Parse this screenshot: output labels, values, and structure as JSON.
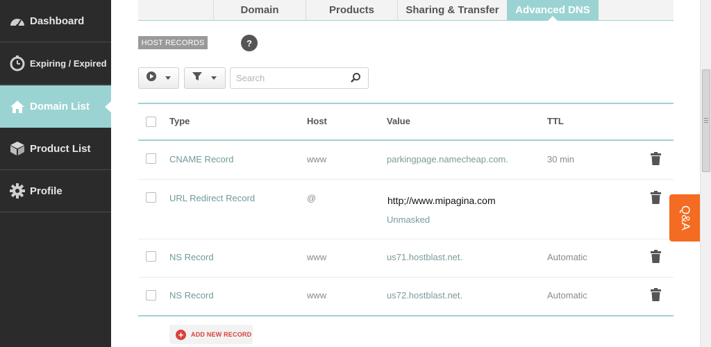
{
  "sidebar": {
    "items": [
      {
        "label": "Dashboard",
        "icon": "gauge-icon"
      },
      {
        "label": "Expiring / Expired",
        "icon": "clock-icon"
      },
      {
        "label": "Domain List",
        "icon": "home-icon",
        "active": true
      },
      {
        "label": "Product List",
        "icon": "box-icon"
      },
      {
        "label": "Profile",
        "icon": "gear-icon"
      }
    ]
  },
  "tabs": [
    {
      "label": "Domain"
    },
    {
      "label": "Products"
    },
    {
      "label": "Sharing & Transfer"
    },
    {
      "label": "Advanced DNS",
      "active": true
    }
  ],
  "host_records": {
    "label": "HOST RECORDS",
    "help": "?"
  },
  "toolbar": {
    "search_placeholder": "Search"
  },
  "table": {
    "columns": [
      "Type",
      "Host",
      "Value",
      "TTL"
    ],
    "rows": [
      {
        "type": "CNAME Record",
        "host": "www",
        "value": "parkingpage.namecheap.com.",
        "ttl": "30 min"
      },
      {
        "type": "URL Redirect Record",
        "host": "@",
        "value": "http;//www.mipagina.com",
        "value_sub": "Unmasked",
        "ttl": ""
      },
      {
        "type": "NS Record",
        "host": "www",
        "value": "us71.hostblast.net.",
        "ttl": "Automatic"
      },
      {
        "type": "NS Record",
        "host": "www",
        "value": "us72.hostblast.net.",
        "ttl": "Automatic"
      }
    ]
  },
  "add_record_label": "ADD NEW RECORD",
  "qa_label": "Q&A",
  "colors": {
    "accent": "#9bd3d3",
    "sidebar_bg": "#2b2b2b",
    "qa": "#f36c21",
    "add": "#d9403a"
  }
}
